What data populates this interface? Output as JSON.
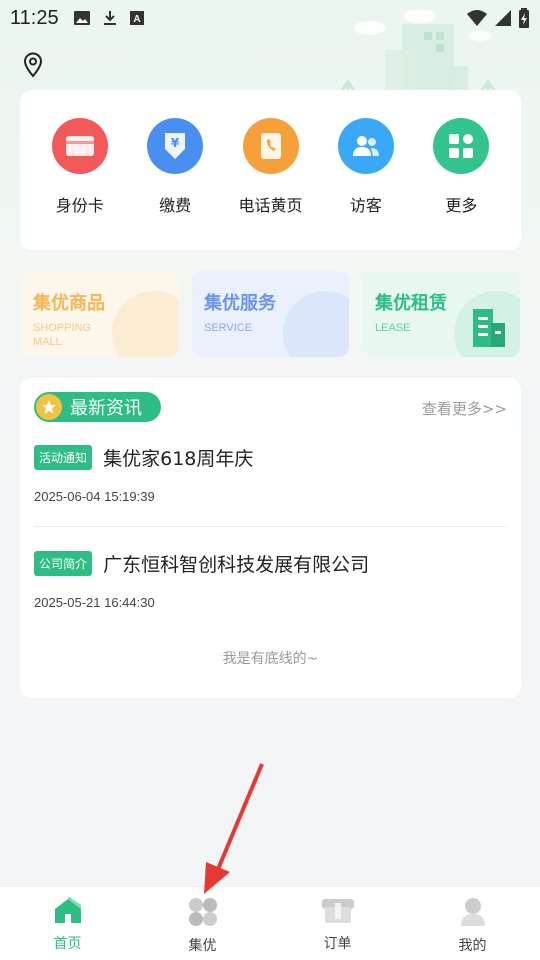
{
  "status": {
    "time": "11:25"
  },
  "quick_actions": [
    {
      "label": "身份卡",
      "icon": "id-card-icon",
      "color": "#f25a5a"
    },
    {
      "label": "缴费",
      "icon": "payment-icon",
      "color": "#4a8ff0"
    },
    {
      "label": "电话黄页",
      "icon": "phonebook-icon",
      "color": "#f5a03a"
    },
    {
      "label": "访客",
      "icon": "visitor-icon",
      "color": "#3aa9f5"
    },
    {
      "label": "更多",
      "icon": "more-grid-icon",
      "color": "#33c48e"
    }
  ],
  "promos": [
    {
      "title": "集优商品",
      "sub1": "SHOPPING",
      "sub2": "MALL",
      "color": "#f5b75a",
      "bg": "#fdf6ea"
    },
    {
      "title": "集优服务",
      "sub1": "SERVICE",
      "sub2": "",
      "color": "#6d95e8",
      "bg": "#eaf1fd"
    },
    {
      "title": "集优租赁",
      "sub1": "LEASE",
      "sub2": "",
      "color": "#2ebd85",
      "bg": "#e8f8f1"
    }
  ],
  "news": {
    "badge": "最新资讯",
    "more": "查看更多>>",
    "items": [
      {
        "tag": "活动通知",
        "title": "集优家618周年庆",
        "time": "2025-06-04 15:19:39"
      },
      {
        "tag": "公司简介",
        "title": "广东恒科智创科技发展有限公司",
        "time": "2025-05-21 16:44:30"
      }
    ],
    "bottom": "我是有底线的~"
  },
  "tabs": [
    {
      "label": "首页",
      "icon": "home-icon"
    },
    {
      "label": "集优",
      "icon": "jiyou-icon"
    },
    {
      "label": "订单",
      "icon": "order-icon"
    },
    {
      "label": "我的",
      "icon": "profile-icon"
    }
  ],
  "colors": {
    "accent": "#2ebd85"
  }
}
